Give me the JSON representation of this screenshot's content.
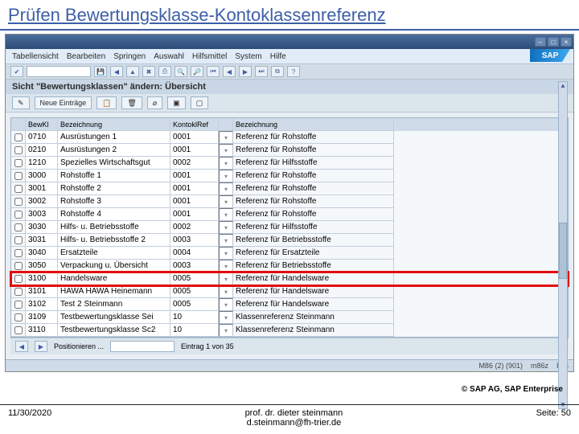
{
  "slide": {
    "title": "Prüfen Bewertungsklasse-Kontoklassenreferenz",
    "date": "11/30/2020",
    "footer_name": "prof. dr. dieter steinmann",
    "footer_email": "d.steinmann@fh-trier.de",
    "page": "Seite: 50",
    "copyright": "© SAP AG, SAP Enterprise"
  },
  "sap": {
    "logo": "SAP",
    "menubar": [
      "Tabellensicht",
      "Bearbeiten",
      "Springen",
      "Auswahl",
      "Hilfsmittel",
      "System",
      "Hilfe"
    ],
    "subtitle": "Sicht \"Bewertungsklassen\" ändern: Übersicht",
    "new_entries": "Neue Einträge",
    "headers": {
      "bwk": "BewKl",
      "bez1": "Bezeichnung",
      "ref": "KontoklRef",
      "bez2": "Bezeichnung"
    },
    "rows": [
      {
        "c1": "0710",
        "c2": "Ausrüstungen 1",
        "c3": "0001",
        "c4": "Referenz für Rohstoffe"
      },
      {
        "c1": "0210",
        "c2": "Ausrüstungen 2",
        "c3": "0001",
        "c4": "Referenz für Rohstoffe"
      },
      {
        "c1": "1210",
        "c2": "Spezielles Wirtschaftsgut",
        "c3": "0002",
        "c4": "Referenz für Hilfsstoffe"
      },
      {
        "c1": "3000",
        "c2": "Rohstoffe 1",
        "c3": "0001",
        "c4": "Referenz für Rohstoffe"
      },
      {
        "c1": "3001",
        "c2": "Rohstoffe 2",
        "c3": "0001",
        "c4": "Referenz für Rohstoffe"
      },
      {
        "c1": "3002",
        "c2": "Rohstoffe 3",
        "c3": "0001",
        "c4": "Referenz für Rohstoffe"
      },
      {
        "c1": "3003",
        "c2": "Rohstoffe 4",
        "c3": "0001",
        "c4": "Referenz für Rohstoffe"
      },
      {
        "c1": "3030",
        "c2": "Hilfs- u. Betriebsstoffe",
        "c3": "0002",
        "c4": "Referenz für Hilfsstoffe"
      },
      {
        "c1": "3031",
        "c2": "Hilfs- u. Betriebsstoffe 2",
        "c3": "0003",
        "c4": "Referenz für Betriebsstoffe"
      },
      {
        "c1": "3040",
        "c2": "Ersatzteile",
        "c3": "0004",
        "c4": "Referenz für Ersatzteile"
      },
      {
        "c1": "3050",
        "c2": "Verpackung u. Übersicht",
        "c3": "0003",
        "c4": "Referenz für Betriebsstoffe"
      },
      {
        "c1": "3100",
        "c2": "Handelsware",
        "c3": "0005",
        "c4": "Referenz für Handelsware",
        "hl": true
      },
      {
        "c1": "3101",
        "c2": "HAWA HAWA Heinemann",
        "c3": "0005",
        "c4": "Referenz für Handelsware"
      },
      {
        "c1": "3102",
        "c2": "Test 2 Steinmann",
        "c3": "0005",
        "c4": "Referenz für Handelsware"
      },
      {
        "c1": "3109",
        "c2": "Testbewertungsklasse Sei",
        "c3": "10",
        "c4": "Klassenreferenz Steinmann"
      },
      {
        "c1": "3110",
        "c2": "Testbewertungsklasse Sc2",
        "c3": "10",
        "c4": "Klassenreferenz Steinmann"
      }
    ],
    "pos_label": "Positionieren ...",
    "entry_count": "Eintrag 1 von 35",
    "statusbar": {
      "sys": "M86 (2) (901)",
      "host": "m86z",
      "mode": "INS"
    }
  }
}
